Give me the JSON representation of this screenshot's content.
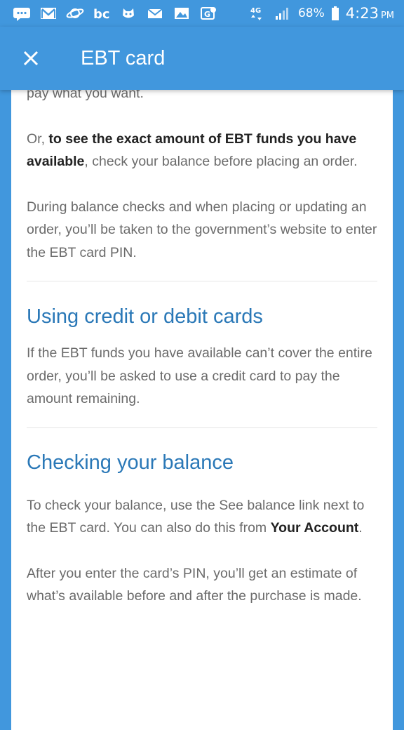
{
  "status_bar": {
    "network": "4G",
    "battery": "68%",
    "time": "4:23",
    "ampm": "PM",
    "icons": [
      "message-icon",
      "gmail-icon",
      "saturn-icon",
      "bc-icon",
      "cat-icon",
      "mail-icon",
      "image-icon",
      "maps-icon"
    ]
  },
  "app_bar": {
    "title": "EBT card",
    "close_icon": "close-icon"
  },
  "content": {
    "p0": "pay what you want.",
    "p1_pre": "Or, ",
    "p1_bold": "to see the exact amount of EBT funds you have available",
    "p1_post": ", check your balance before placing an order.",
    "p2": "During balance checks and when placing or updating an order, you’ll be taken to the government’s website to enter the EBT card PIN.",
    "h1": "Using credit or debit cards",
    "p3": "If the EBT funds you have available can’t cover the entire order, you’ll be asked to use a credit card to pay the amount remaining.",
    "h2": "Checking your balance",
    "p4_pre": "To check your balance, use the See balance link next to the EBT card. You can also do this from ",
    "p4_bold": "Your Account",
    "p4_post": ".",
    "p5": "After you enter the card’s PIN, you’ll get an estimate of what’s available before and after the purchase is made."
  },
  "colors": {
    "primary": "#4197dd",
    "heading": "#2a78b7",
    "body_text": "#6b6b6b",
    "bold_text": "#222222"
  }
}
